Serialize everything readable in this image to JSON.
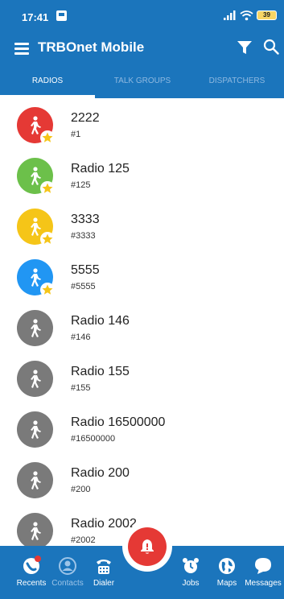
{
  "status_bar": {
    "time": "17:41",
    "battery": "39"
  },
  "app_bar": {
    "title": "TRBOnet Mobile"
  },
  "tabs": [
    {
      "label": "RADIOS",
      "active": true
    },
    {
      "label": "TALK GROUPS",
      "active": false
    },
    {
      "label": "DISPATCHERS",
      "active": false
    }
  ],
  "radios": [
    {
      "name": "2222",
      "id": "#1",
      "color": "#e53935",
      "favorite": true
    },
    {
      "name": "Radio 125",
      "id": "#125",
      "color": "#6cc04a",
      "favorite": true
    },
    {
      "name": "3333",
      "id": "#3333",
      "color": "#f5c518",
      "favorite": true
    },
    {
      "name": "5555",
      "id": "#5555",
      "color": "#2196f3",
      "favorite": true
    },
    {
      "name": "Radio 146",
      "id": "#146",
      "color": "#7a7a7a",
      "favorite": false
    },
    {
      "name": "Radio 155",
      "id": "#155",
      "color": "#7a7a7a",
      "favorite": false
    },
    {
      "name": "Radio 16500000",
      "id": "#16500000",
      "color": "#7a7a7a",
      "favorite": false
    },
    {
      "name": "Radio 200",
      "id": "#200",
      "color": "#7a7a7a",
      "favorite": false
    },
    {
      "name": "Radio 2002",
      "id": "#2002",
      "color": "#7a7a7a",
      "favorite": false
    }
  ],
  "bottom_nav": {
    "recents": "Recents",
    "contacts": "Contacts",
    "dialer": "Dialer",
    "jobs": "Jobs",
    "maps": "Maps",
    "messages": "Messages"
  },
  "colors": {
    "primary": "#1b75bc",
    "alarm": "#e53935",
    "star": "#f5c518"
  }
}
